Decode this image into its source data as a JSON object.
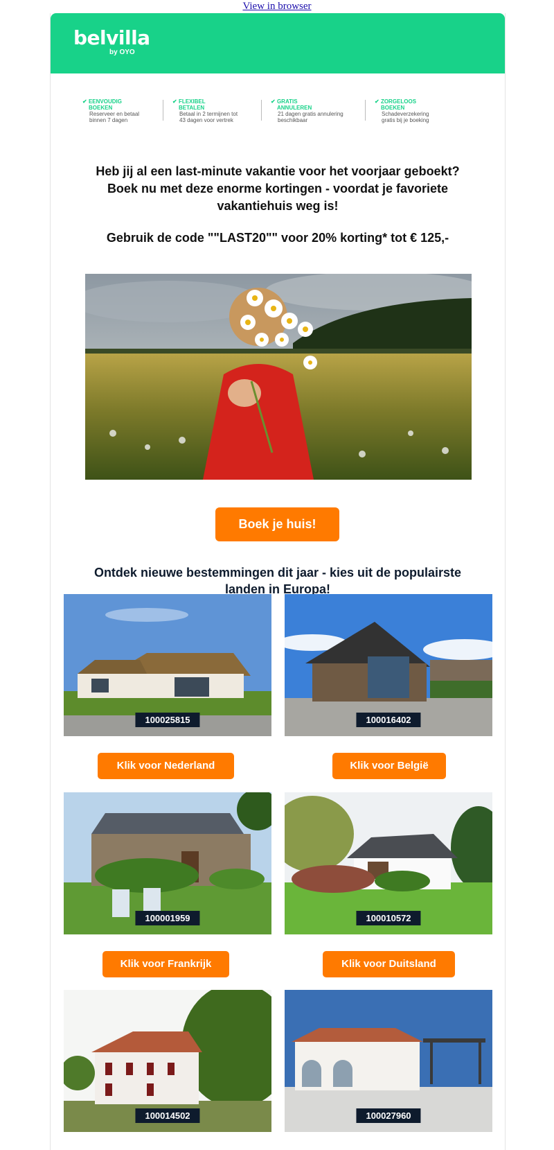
{
  "topbar": {
    "view_in_browser": "View in browser"
  },
  "brand": {
    "name": "belvilla",
    "by": "by OYO"
  },
  "usps": [
    {
      "title_1": "EENVOUDIG",
      "title_2": "BOEKEN",
      "desc_1": "Reserveer en betaal",
      "desc_2": "binnen 7 dagen"
    },
    {
      "title_1": "FLEXIBEL",
      "title_2": "BETALEN",
      "desc_1": "Betaal in 2 termijnen tot",
      "desc_2": "43 dagen voor vertrek"
    },
    {
      "title_1": "GRATIS",
      "title_2": "ANNULEREN",
      "desc_1": "21 dagen gratis annulering",
      "desc_2": "beschikbaar"
    },
    {
      "title_1": "ZORGELOOS",
      "title_2": "BOEKEN",
      "desc_1": "Schadeverzekering",
      "desc_2": "gratis bij je boeking"
    }
  ],
  "intro": {
    "line1": "Heb jij al een last-minute vakantie voor het voorjaar geboekt?",
    "line2": "Boek nu met deze enorme kortingen - voordat je favoriete",
    "line3": "vakantiehuis weg is!"
  },
  "code_line": "Gebruik de code \"\"LAST20\"\" voor 20% korting* tot € 125,-",
  "cta_main": "Boek je huis!",
  "destinations_title": {
    "line1": "Ontdek nieuwe bestemmingen dit jaar - kies uit de populairste",
    "line2": "landen in Europa!"
  },
  "houses": [
    {
      "id": "100025815",
      "button": "Klik voor Nederland"
    },
    {
      "id": "100016402",
      "button": "Klik voor België"
    },
    {
      "id": "100001959",
      "button": "Klik voor Frankrijk"
    },
    {
      "id": "100010572",
      "button": "Klik voor Duitsland"
    },
    {
      "id": "100014502"
    },
    {
      "id": "100027960"
    }
  ],
  "colors": {
    "brand_green": "#18d289",
    "cta_orange": "#ff7a00",
    "badge_navy": "#0e1b2d"
  }
}
